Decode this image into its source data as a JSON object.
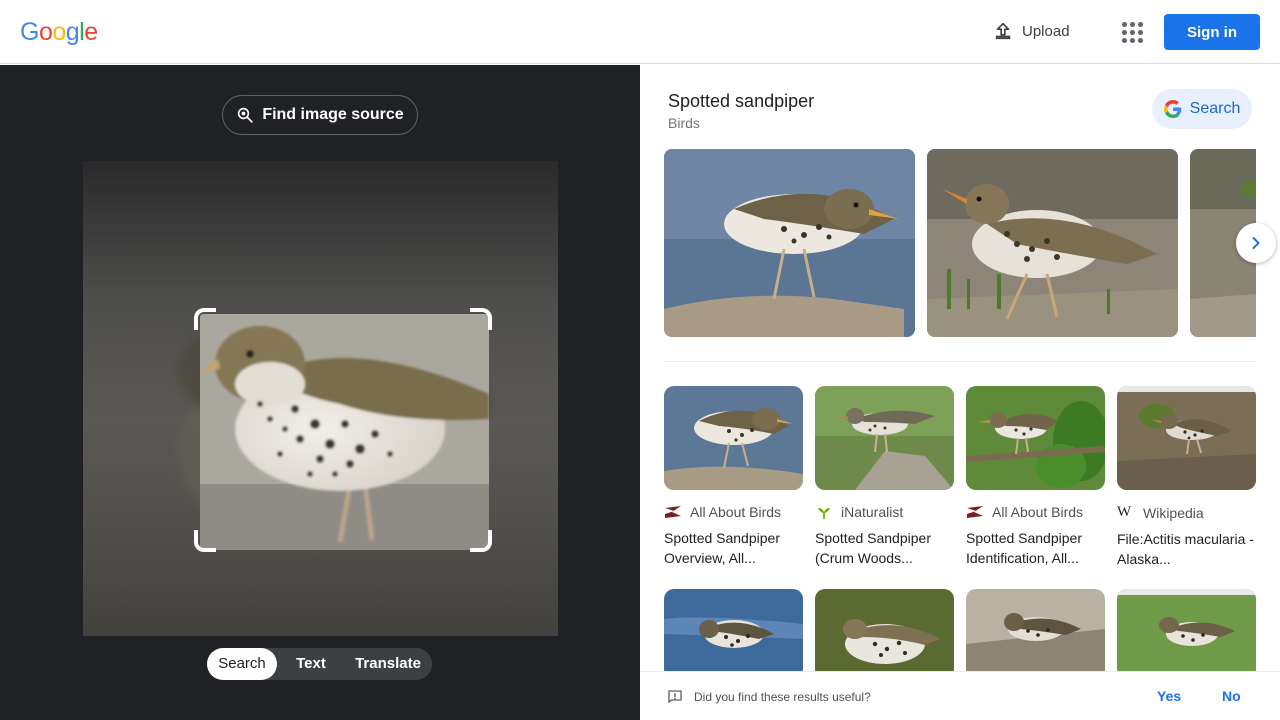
{
  "header": {
    "logo": [
      "G",
      "o",
      "o",
      "g",
      "l",
      "e"
    ],
    "logo_colors": [
      "#4285F4",
      "#EA4335",
      "#FBBC05",
      "#4285F4",
      "#34A853",
      "#EA4335"
    ],
    "upload_label": "Upload",
    "signin_label": "Sign in"
  },
  "left": {
    "find_source_label": "Find image source",
    "modes": [
      "Search",
      "Text",
      "Translate"
    ],
    "active_mode": "Search"
  },
  "right": {
    "title": "Spotted sandpiper",
    "subtitle": "Birds",
    "search_label": "Search",
    "results": [
      {
        "source": "All About Birds",
        "title": "Spotted Sandpiper Overview, All..."
      },
      {
        "source": "iNaturalist",
        "title": "Spotted Sandpiper (Crum Woods..."
      },
      {
        "source": "All About Birds",
        "title": "Spotted Sandpiper Identification, All..."
      },
      {
        "source": "Wikipedia",
        "title": "File:Actitis macularia -Alaska..."
      }
    ],
    "feedback": {
      "question": "Did you find these results useful?",
      "yes": "Yes",
      "no": "No"
    }
  },
  "colors": {
    "accent": "#1a73e8",
    "left_bg": "#202124"
  }
}
